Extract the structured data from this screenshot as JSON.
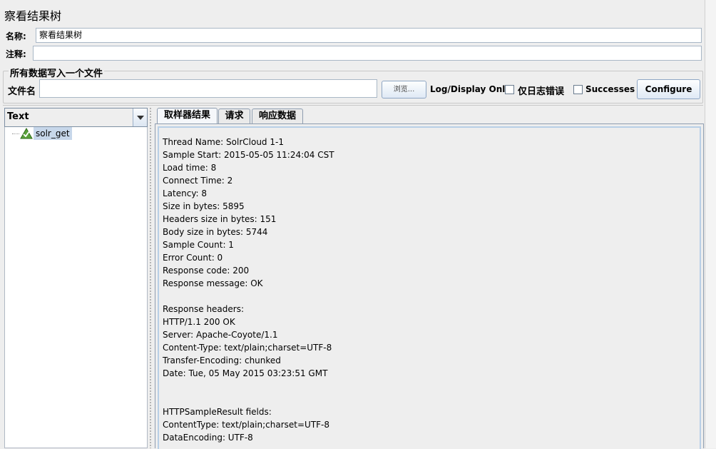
{
  "page": {
    "title": "察看结果树"
  },
  "name_field": {
    "label": "名称:",
    "value": "察看结果树"
  },
  "comment_field": {
    "label": "注释:",
    "value": ""
  },
  "file_group": {
    "legend": "所有数据写入一个文件",
    "filename_label": "文件名",
    "filename_value": "",
    "browse_label": "浏览...",
    "log_display_label": "Log/Display Only:",
    "errors_label": "仅日志错误",
    "errors_checked": false,
    "successes_label": "Successes",
    "successes_checked": false,
    "configure_label": "Configure"
  },
  "renderer": {
    "selected": "Text"
  },
  "tree": {
    "items": [
      {
        "label": "solr_get",
        "icon": "success-triangle-icon"
      }
    ]
  },
  "tabs": [
    {
      "label": "取样器结果",
      "selected": true
    },
    {
      "label": "请求",
      "selected": false
    },
    {
      "label": "响应数据",
      "selected": false
    }
  ],
  "result_lines": [
    "Thread Name: SolrCloud 1-1",
    "Sample Start: 2015-05-05 11:24:04 CST",
    "Load time: 8",
    "Connect Time: 2",
    "Latency: 8",
    "Size in bytes: 5895",
    "Headers size in bytes: 151",
    "Body size in bytes: 5744",
    "Sample Count: 1",
    "Error Count: 0",
    "Response code: 200",
    "Response message: OK",
    "",
    "Response headers:",
    "HTTP/1.1 200 OK",
    "Server: Apache-Coyote/1.1",
    "Content-Type: text/plain;charset=UTF-8",
    "Transfer-Encoding: chunked",
    "Date: Tue, 05 May 2015 03:23:51 GMT",
    "",
    "",
    "HTTPSampleResult fields:",
    "ContentType: text/plain;charset=UTF-8",
    "DataEncoding: UTF-8"
  ],
  "colors": {
    "background": "#eeeeee",
    "selection": "#c7d7ea",
    "border": "#8ea6c4"
  }
}
